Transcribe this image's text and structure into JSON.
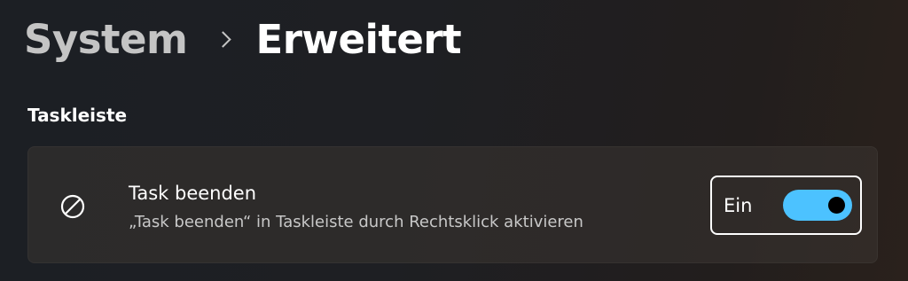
{
  "breadcrumb": {
    "parent": "System",
    "current": "Erweitert"
  },
  "section": {
    "title": "Taskleiste"
  },
  "setting": {
    "icon": "block-icon",
    "title": "Task beenden",
    "description": "„Task beenden“ in Taskleiste durch Rechtsklick aktivieren",
    "toggle_label": "Ein",
    "toggle_on": true
  },
  "colors": {
    "accent": "#4cc2ff",
    "card_background": "#2d2a28",
    "secondary_text": "#c8c8c8"
  }
}
